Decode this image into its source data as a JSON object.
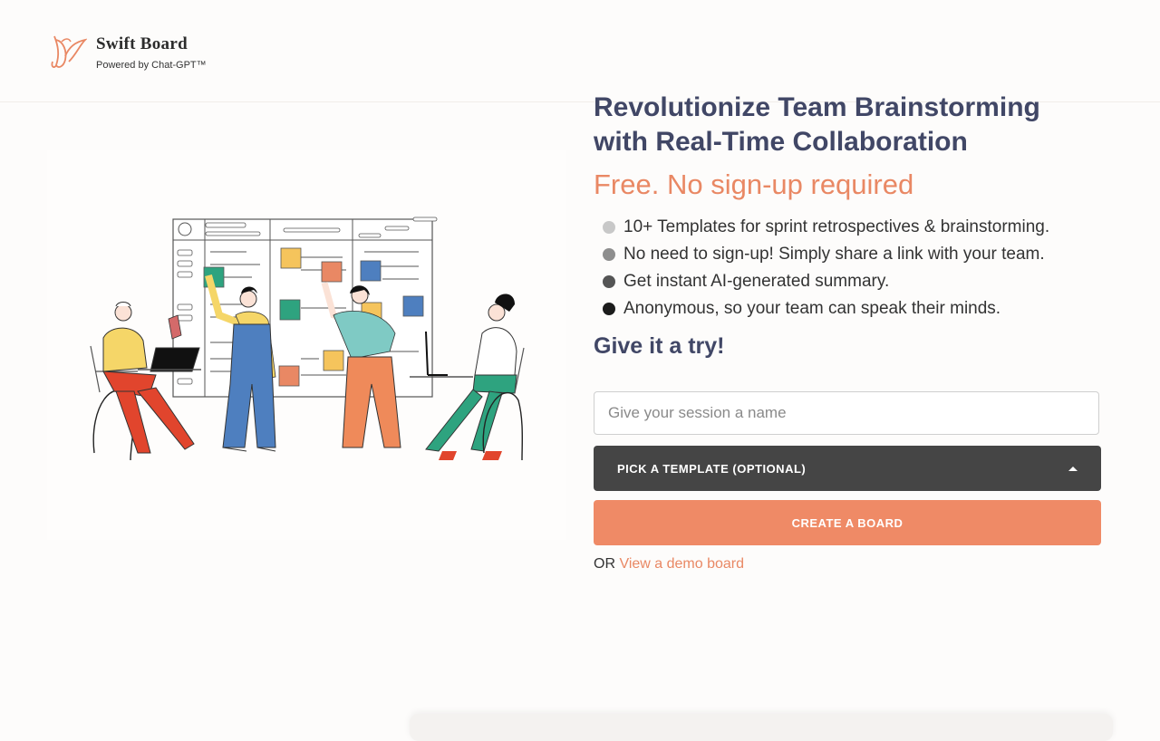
{
  "header": {
    "brand_name": "Swift Board",
    "brand_sub": "Powered by Chat-GPT™"
  },
  "hero": {
    "title_line1": "Revolutionize Team Brainstorming",
    "title_line2": "with Real-Time Collaboration",
    "subtitle": "Free. No sign-up required",
    "features": [
      {
        "text": "10+ Templates for sprint retrospectives & brainstorming.",
        "dot_color": "#c8c8c8"
      },
      {
        "text": "No need to sign-up! Simply share a link with your team.",
        "dot_color": "#8e8e8e"
      },
      {
        "text": "Get instant AI-generated summary.",
        "dot_color": "#555555"
      },
      {
        "text": "Anonymous, so your team can speak their minds.",
        "dot_color": "#1c1c1c"
      }
    ],
    "try_label": "Give it a try!"
  },
  "form": {
    "session_placeholder": "Give your session a name",
    "template_label": "PICK A TEMPLATE (OPTIONAL)",
    "create_label": "CREATE A BOARD",
    "or_text": "OR",
    "demo_link": "View a demo board"
  },
  "colors": {
    "accent": "#ef8a66",
    "title": "#414766",
    "select_bg": "#454545"
  },
  "icons": {
    "logo": "bird-logo-icon",
    "caret": "caret-up-icon"
  }
}
